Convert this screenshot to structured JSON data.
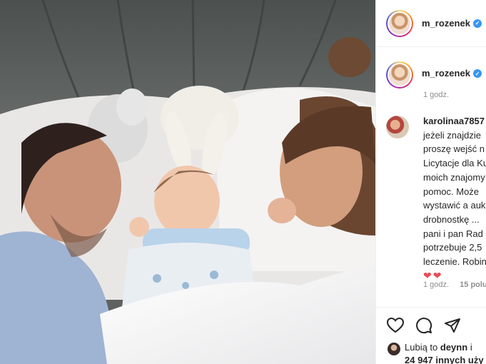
{
  "header": {
    "username": "m_rozenek",
    "verified_icon": "verified-badge-icon"
  },
  "post": {
    "username": "m_rozenek",
    "time": "1 godz."
  },
  "comment": {
    "username": "karolinaa7857",
    "lines": [
      "jeżeli znajdzie",
      "proszę wejść n",
      "Licytacje dla Ku",
      "moich znajomy",
      "pomoc. Może",
      "wystawić a auk",
      "drobnostkę ...",
      "pani i pan Rad",
      "potrzebuje 2,5",
      "leczenie. Robin"
    ],
    "hearts": "❤❤",
    "time": "1 godz.",
    "likes": "15 polu"
  },
  "actions": {
    "like_icon": "heart-icon",
    "comment_icon": "comment-icon",
    "share_icon": "share-icon"
  },
  "liked_by": {
    "prefix": "Lubią to",
    "user": "deynn",
    "and": "i",
    "others": "24 947 innych uży"
  },
  "colors": {
    "verified": "#3897f0",
    "meta_text": "#8e8e8e",
    "heart": "#ed4956"
  }
}
